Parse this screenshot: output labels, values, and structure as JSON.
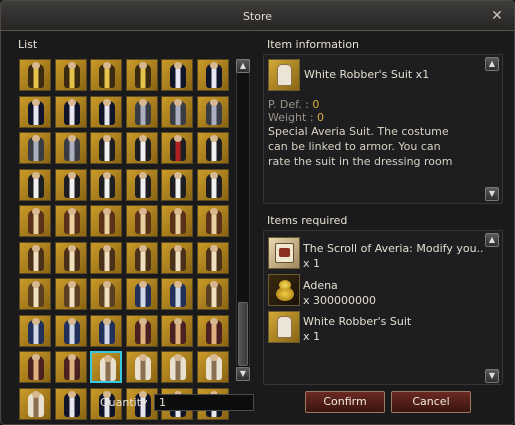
{
  "window": {
    "title": "Store"
  },
  "list": {
    "label": "List",
    "items": [
      {
        "fig": "#3a2a10",
        "trim": "#e6c34a"
      },
      {
        "fig": "#3a2a10",
        "trim": "#e6c34a"
      },
      {
        "fig": "#3a2a10",
        "trim": "#e6c34a"
      },
      {
        "fig": "#3a2a10",
        "trim": "#e6c34a"
      },
      {
        "fig": "#101428",
        "trim": "#e6e6f0"
      },
      {
        "fig": "#101428",
        "trim": "#e6e6f0"
      },
      {
        "fig": "#101428",
        "trim": "#e6e6f0"
      },
      {
        "fig": "#101428",
        "trim": "#e6e6f0"
      },
      {
        "fig": "#101428",
        "trim": "#e6e6f0"
      },
      {
        "fig": "#3a3c44",
        "trim": "#aab0c0"
      },
      {
        "fig": "#3a3c44",
        "trim": "#aab0c0"
      },
      {
        "fig": "#3a3c44",
        "trim": "#aab0c0"
      },
      {
        "fig": "#3a3c44",
        "trim": "#aab0c0"
      },
      {
        "fig": "#3a3c44",
        "trim": "#aab0c0"
      },
      {
        "fig": "#1e1e22",
        "trim": "#f0f0f0"
      },
      {
        "fig": "#1e1e22",
        "trim": "#f0f0f0"
      },
      {
        "fig": "#1e1e22",
        "trim": "#b02020"
      },
      {
        "fig": "#1e1e22",
        "trim": "#f0f0f0"
      },
      {
        "fig": "#1e1e22",
        "trim": "#f0f0f0"
      },
      {
        "fig": "#1e1e22",
        "trim": "#f0f0f0"
      },
      {
        "fig": "#1e1e22",
        "trim": "#f0f0f0"
      },
      {
        "fig": "#1e1e22",
        "trim": "#f0f0f0"
      },
      {
        "fig": "#1e1e22",
        "trim": "#f0f0f0"
      },
      {
        "fig": "#1e1e22",
        "trim": "#f0f0f0"
      },
      {
        "fig": "#5a3018",
        "trim": "#e8d0a0"
      },
      {
        "fig": "#5a3018",
        "trim": "#e8d0a0"
      },
      {
        "fig": "#5a3018",
        "trim": "#e8d0a0"
      },
      {
        "fig": "#5a3018",
        "trim": "#e8d0a0"
      },
      {
        "fig": "#5a3018",
        "trim": "#e8d0a0"
      },
      {
        "fig": "#5a3018",
        "trim": "#e8d0a0"
      },
      {
        "fig": "#4a3018",
        "trim": "#f0e0c0"
      },
      {
        "fig": "#4a3018",
        "trim": "#f0e0c0"
      },
      {
        "fig": "#4a3018",
        "trim": "#f0e0c0"
      },
      {
        "fig": "#4a3018",
        "trim": "#f0e0c0"
      },
      {
        "fig": "#4a3018",
        "trim": "#f0e0c0"
      },
      {
        "fig": "#4a3018",
        "trim": "#f0e0c0"
      },
      {
        "fig": "#5a4020",
        "trim": "#f0e0c0"
      },
      {
        "fig": "#5a4020",
        "trim": "#f0e0c0"
      },
      {
        "fig": "#5a4020",
        "trim": "#f0e0c0"
      },
      {
        "fig": "#20305a",
        "trim": "#d0d8e8"
      },
      {
        "fig": "#20305a",
        "trim": "#d0d8e8"
      },
      {
        "fig": "#5a4020",
        "trim": "#f0e0c0"
      },
      {
        "fig": "#20305a",
        "trim": "#d0d8e8"
      },
      {
        "fig": "#20305a",
        "trim": "#d0d8e8"
      },
      {
        "fig": "#20305a",
        "trim": "#d0d8e8"
      },
      {
        "fig": "#4a2020",
        "trim": "#e0b080"
      },
      {
        "fig": "#4a2020",
        "trim": "#e0b080"
      },
      {
        "fig": "#4a2020",
        "trim": "#e0b080"
      },
      {
        "fig": "#4a2020",
        "trim": "#e0b080"
      },
      {
        "fig": "#4a2020",
        "trim": "#e0b080"
      },
      {
        "fig": "#e8e0d0",
        "trim": "#8a7050",
        "selected": true
      },
      {
        "fig": "#e8e0d0",
        "trim": "#8a7050"
      },
      {
        "fig": "#e8e0d0",
        "trim": "#8a7050"
      },
      {
        "fig": "#e8e0d0",
        "trim": "#8a7050"
      },
      {
        "fig": "#e8e0d0",
        "trim": "#8a7050"
      },
      {
        "fig": "#101428",
        "trim": "#e6e6f0"
      },
      {
        "fig": "#101428",
        "trim": "#e6e6f0"
      },
      {
        "fig": "#101428",
        "trim": "#e6e6f0"
      },
      {
        "fig": "#101428",
        "trim": "#e6e6f0"
      },
      {
        "fig": "#101428",
        "trim": "#e6e6f0"
      }
    ]
  },
  "item_information": {
    "label": "Item information",
    "name": "White Robber's Suit x1",
    "pdef_label": "P. Def. : ",
    "pdef_value": "0",
    "weight_label": "Weight : ",
    "weight_value": "0",
    "description": "Special Averia Suit. The costume can be linked to armor. You can rate the suit in the dressing room"
  },
  "items_required": {
    "label": "Items required",
    "items": [
      {
        "name": "The Scroll of Averia: Modify you..",
        "count": "x 1",
        "icon": "scroll-icon"
      },
      {
        "name": "Adena",
        "count": "x 300000000",
        "icon": "adena-icon"
      },
      {
        "name": "White Robber's Suit",
        "count": "x 1",
        "icon": "suit-icon"
      }
    ]
  },
  "quantity": {
    "label": "Quantity",
    "value": "1"
  },
  "buttons": {
    "confirm": "Confirm",
    "cancel": "Cancel"
  },
  "colors": {
    "accent_gold": "#d9b040",
    "selection": "#38c8e0",
    "button_red": "#6a2a22"
  }
}
